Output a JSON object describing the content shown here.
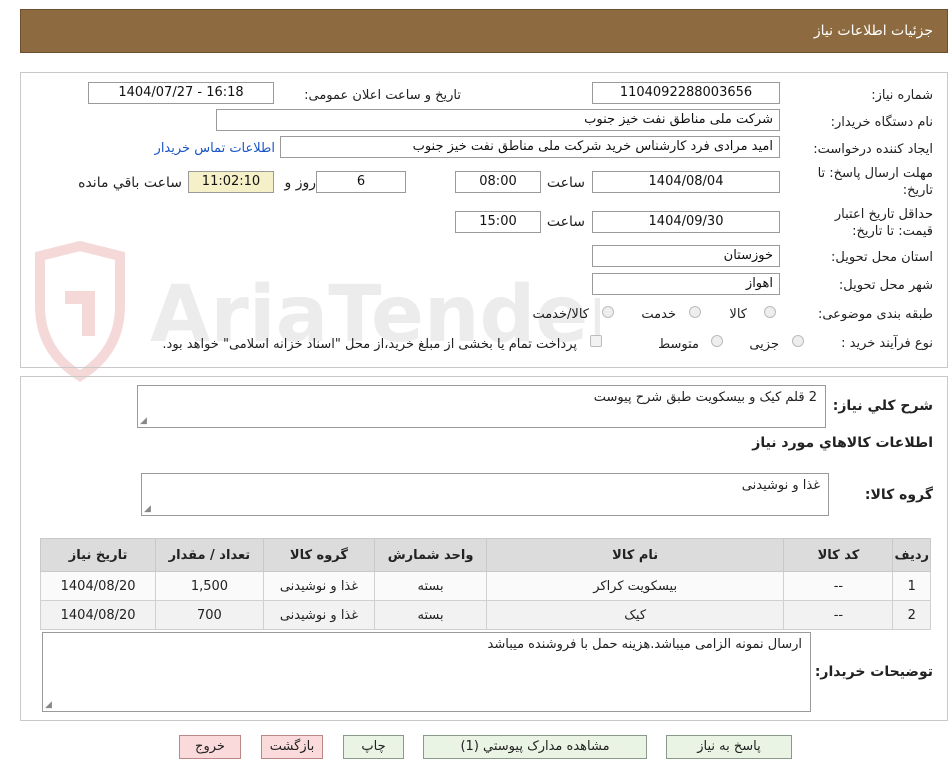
{
  "header": {
    "title": "جزئیات اطلاعات نیاز"
  },
  "details": {
    "need_number_label": "شماره نیاز:",
    "need_number": "1104092288003656",
    "announce_label": "تاریخ و ساعت اعلان عمومی:",
    "announce_value": "1404/07/27 - 16:18",
    "buyer_org_label": "نام دستگاه خریدار:",
    "buyer_org": "شرکت ملی مناطق نفت خیز جنوب",
    "creator_label": "ایجاد کننده درخواست:",
    "creator": "امید مرادی فرد کارشناس خرید شرکت ملی مناطق نفت خیز جنوب",
    "contact_link": "اطلاعات تماس خریدار",
    "deadline_label_1": "مهلت ارسال پاسخ: تا",
    "deadline_label_2": "تاریخ:",
    "deadline_date": "1404/08/04",
    "time_label": "ساعت",
    "deadline_time": "08:00",
    "days_value": "6",
    "days_label": "روز و",
    "remaining_time": "11:02:10",
    "remaining_label": "ساعت باقي مانده",
    "validity_label_1": "حداقل تاریخ اعتبار",
    "validity_label_2": "قیمت: تا تاریخ:",
    "validity_date": "1404/09/30",
    "validity_time": "15:00",
    "province_label": "استان محل تحویل:",
    "province": "خوزستان",
    "city_label": "شهر محل تحویل:",
    "city": "اهواز",
    "category_label": "طبقه بندی موضوعی:",
    "category_options": [
      "کالا",
      "خدمت",
      "کالا/خدمت"
    ],
    "process_label": "نوع فرآیند خرید :",
    "process_options": [
      "جزیی",
      "متوسط"
    ],
    "payment_note": "پرداخت تمام یا بخشی از مبلغ خرید،از محل \"اسناد خزانه اسلامی\" خواهد بود."
  },
  "summary": {
    "label": "شرح کلي نياز:",
    "value": "2 قلم کیک و بیسکویت طبق شرح پیوست"
  },
  "goods_section": {
    "title": "اطلاعات کالاهاي مورد نياز",
    "group_label": "گروه کالا:",
    "group_value": "غذا و نوشیدنی"
  },
  "table": {
    "headers": [
      "رديف",
      "کد کالا",
      "نام کالا",
      "واحد شمارش",
      "گروه کالا",
      "تعداد / مقدار",
      "تاریخ نیاز"
    ],
    "rows": [
      [
        "1",
        "--",
        "بیسکویت کراکر",
        "بسته",
        "غذا و نوشیدنی",
        "1,500",
        "1404/08/20"
      ],
      [
        "2",
        "--",
        "کیک",
        "بسته",
        "غذا و نوشیدنی",
        "700",
        "1404/08/20"
      ]
    ]
  },
  "buyer_notes": {
    "label": "توضیحات خریدار:",
    "value": "ارسال نمونه الزامی میباشد.هزینه حمل با فروشنده میباشد"
  },
  "buttons": {
    "reply": "پاسخ به نياز",
    "attachments": "مشاهده مدارک پیوستي (1)",
    "print": "چاپ",
    "back": "بازگشت",
    "exit": "خروج"
  },
  "watermark": {
    "text": "AriaTender.net"
  },
  "colors": {
    "header_bg": "#8d6a3f",
    "link": "#1a55c8",
    "remaining_bg": "#f5f0c8",
    "button_bg": "#eaf4e4",
    "button_pink": "#fadada"
  }
}
